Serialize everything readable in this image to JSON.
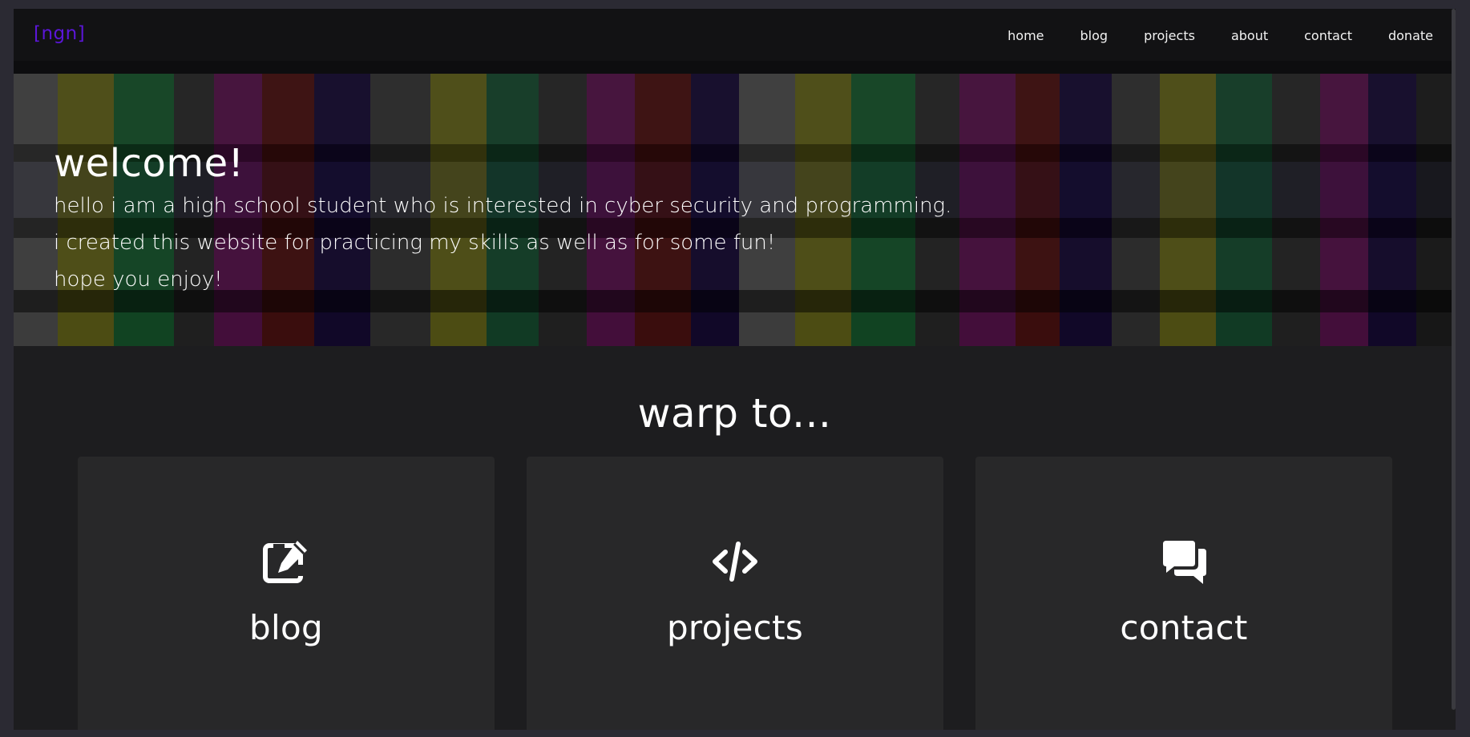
{
  "site": {
    "logo": "[ngn]",
    "logo_color": "#5b16d8"
  },
  "nav": {
    "items": [
      {
        "label": "home"
      },
      {
        "label": "blog"
      },
      {
        "label": "projects"
      },
      {
        "label": "about"
      },
      {
        "label": "contact"
      },
      {
        "label": "donate"
      }
    ]
  },
  "hero": {
    "title": "welcome!",
    "lines": [
      "hello i am a high school student who is interested in cyber security and programming.",
      "i created this website for practicing my skills as well as for some fun!",
      "hope you enjoy!"
    ]
  },
  "warp": {
    "title": "warp to...",
    "cards": [
      {
        "label": "blog",
        "icon": "edit-icon"
      },
      {
        "label": "projects",
        "icon": "code-icon"
      },
      {
        "label": "contact",
        "icon": "comments-icon"
      }
    ]
  },
  "colors": {
    "page_bg": "#1d1d1f",
    "navbar_bg": "#121214",
    "card_bg": "#282829",
    "text": "#ffffff"
  }
}
